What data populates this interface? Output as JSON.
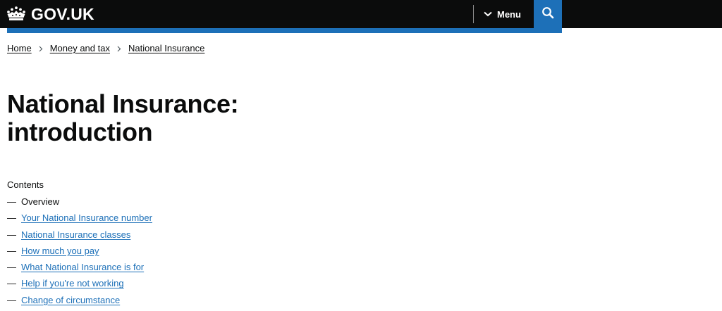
{
  "header": {
    "logo_text": "GOV.UK",
    "logo_icon": "crown-icon",
    "menu_label": "Menu",
    "menu_icon": "chevron-down-icon",
    "search_icon": "search-icon",
    "search_label": "Search",
    "colors": {
      "background": "#0b0c0c",
      "accent": "#1d70b8"
    }
  },
  "breadcrumb": [
    {
      "label": "Home"
    },
    {
      "label": "Money and tax"
    },
    {
      "label": "National Insurance"
    }
  ],
  "page": {
    "title_line1": "National Insurance:",
    "title_line2": "introduction"
  },
  "contents": {
    "heading": "Contents",
    "items": [
      {
        "label": "Overview",
        "current": true
      },
      {
        "label": "Your National Insurance number",
        "current": false
      },
      {
        "label": "National Insurance classes",
        "current": false
      },
      {
        "label": "How much you pay",
        "current": false
      },
      {
        "label": "What National Insurance is for",
        "current": false
      },
      {
        "label": "Help if you're not working",
        "current": false
      },
      {
        "label": "Change of circumstance",
        "current": false
      }
    ]
  },
  "colors": {
    "link": "#1d70b8",
    "text": "#0b0c0c"
  }
}
